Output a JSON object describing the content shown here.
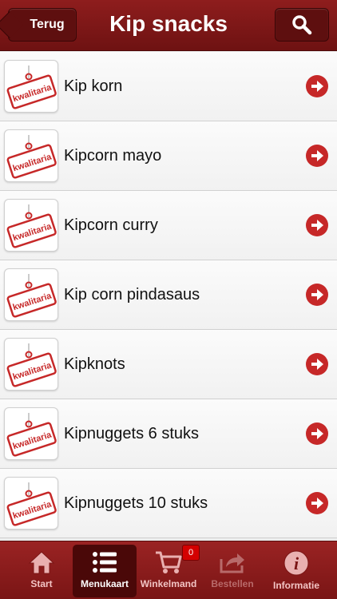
{
  "header": {
    "title": "Kip snacks",
    "back_label": "Terug"
  },
  "items": [
    {
      "label": "Kip korn",
      "logo": "kwalitaria"
    },
    {
      "label": "Kipcorn mayo",
      "logo": "kwalitaria"
    },
    {
      "label": "Kipcorn curry",
      "logo": "kwalitaria"
    },
    {
      "label": "Kip corn pindasaus",
      "logo": "kwalitaria"
    },
    {
      "label": "Kipknots",
      "logo": "kwalitaria"
    },
    {
      "label": "Kipnuggets 6 stuks",
      "logo": "kwalitaria"
    },
    {
      "label": "Kipnuggets 10 stuks",
      "logo": "kwalitaria"
    }
  ],
  "tabs": [
    {
      "label": "Start",
      "icon": "home-icon"
    },
    {
      "label": "Menukaart",
      "icon": "menu-list-icon",
      "active": true
    },
    {
      "label": "Winkelmand",
      "icon": "cart-icon",
      "badge": "0"
    },
    {
      "label": "Bestellen",
      "icon": "share-icon",
      "disabled": true
    },
    {
      "label": "Informatie",
      "icon": "info-icon"
    }
  ],
  "colors": {
    "brand": "#8e1d1d",
    "accent": "#c62828",
    "tab_active": "#4a0808"
  }
}
